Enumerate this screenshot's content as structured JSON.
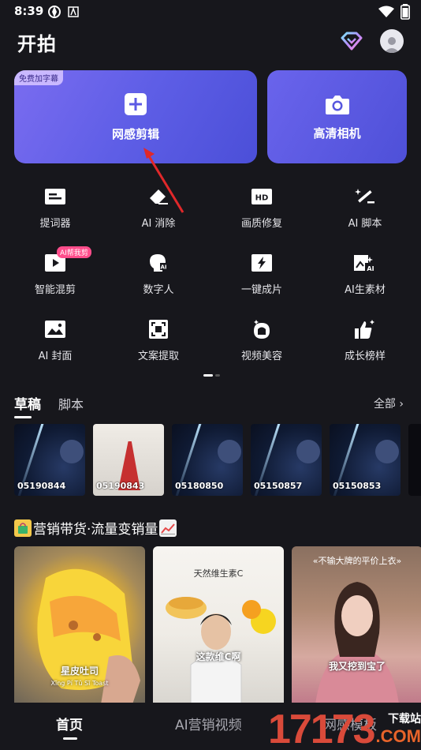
{
  "status": {
    "time": "8:39"
  },
  "header": {
    "title": "开拍"
  },
  "cards": {
    "main": {
      "label": "网感剪辑",
      "badge": "免费加字幕"
    },
    "camera": {
      "label": "高清相机"
    }
  },
  "tools": [
    {
      "label": "提词器"
    },
    {
      "label": "AI 消除"
    },
    {
      "label": "画质修复"
    },
    {
      "label": "AI 脚本"
    },
    {
      "label": "智能混剪",
      "badge": "AI帮我剪"
    },
    {
      "label": "数字人"
    },
    {
      "label": "一键成片"
    },
    {
      "label": "AI生素材"
    },
    {
      "label": "AI 封面"
    },
    {
      "label": "文案提取"
    },
    {
      "label": "视频美容"
    },
    {
      "label": "成长榜样"
    }
  ],
  "tabs": {
    "active": "草稿",
    "other": "脚本",
    "see_all": "全部 ›"
  },
  "drafts": [
    {
      "id": "05190844"
    },
    {
      "id": "05190843"
    },
    {
      "id": "05180850"
    },
    {
      "id": "05150857"
    },
    {
      "id": "05150853"
    }
  ],
  "section": {
    "title": "营销带货·流量变销量"
  },
  "videos": [
    {
      "caption": "星皮吐司",
      "sub": "Xīng Pí Tǔ Sī Toast"
    },
    {
      "top": "天然维生素C",
      "caption": "这款维C啊"
    },
    {
      "top": "«不输大牌的平价上衣»",
      "caption": "我又挖到宝了"
    }
  ],
  "nav": {
    "home": "首页",
    "ai_video": "AI营销视频",
    "templates": "网感模板"
  },
  "watermark": {
    "number": "17173",
    "cn": "下载站",
    "com": ".COM"
  },
  "colors": {
    "accent": "#5e5ee6",
    "badge": "#ff4d8b"
  }
}
